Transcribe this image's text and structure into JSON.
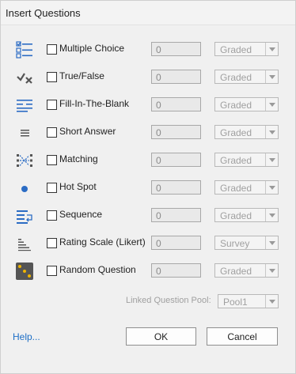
{
  "window": {
    "title": "Insert Questions"
  },
  "colors": {
    "icon_blue": "#2b6cc4",
    "icon_dark": "#555555",
    "link_blue": "#1e6fc6",
    "field_bg": "#e9e9e9"
  },
  "questions": [
    {
      "label": "Multiple Choice",
      "icon": "multiple-choice-icon",
      "count": "0",
      "mode": "Graded"
    },
    {
      "label": "True/False",
      "icon": "true-false-icon",
      "count": "0",
      "mode": "Graded"
    },
    {
      "label": "Fill-In-The-Blank",
      "icon": "fill-in-blank-icon",
      "count": "0",
      "mode": "Graded"
    },
    {
      "label": "Short Answer",
      "icon": "short-answer-icon",
      "count": "0",
      "mode": "Graded"
    },
    {
      "label": "Matching",
      "icon": "matching-icon",
      "count": "0",
      "mode": "Graded"
    },
    {
      "label": "Hot Spot",
      "icon": "hot-spot-icon",
      "count": "0",
      "mode": "Graded"
    },
    {
      "label": "Sequence",
      "icon": "sequence-icon",
      "count": "0",
      "mode": "Graded"
    },
    {
      "label": "Rating Scale (Likert)",
      "icon": "rating-scale-icon",
      "count": "0",
      "mode": "Survey"
    },
    {
      "label": "Random Question",
      "icon": "random-question-icon",
      "count": "0",
      "mode": "Graded"
    }
  ],
  "pool": {
    "label": "Linked Question Pool:",
    "value": "Pool1"
  },
  "footer": {
    "help": "Help...",
    "ok": "OK",
    "cancel": "Cancel"
  }
}
